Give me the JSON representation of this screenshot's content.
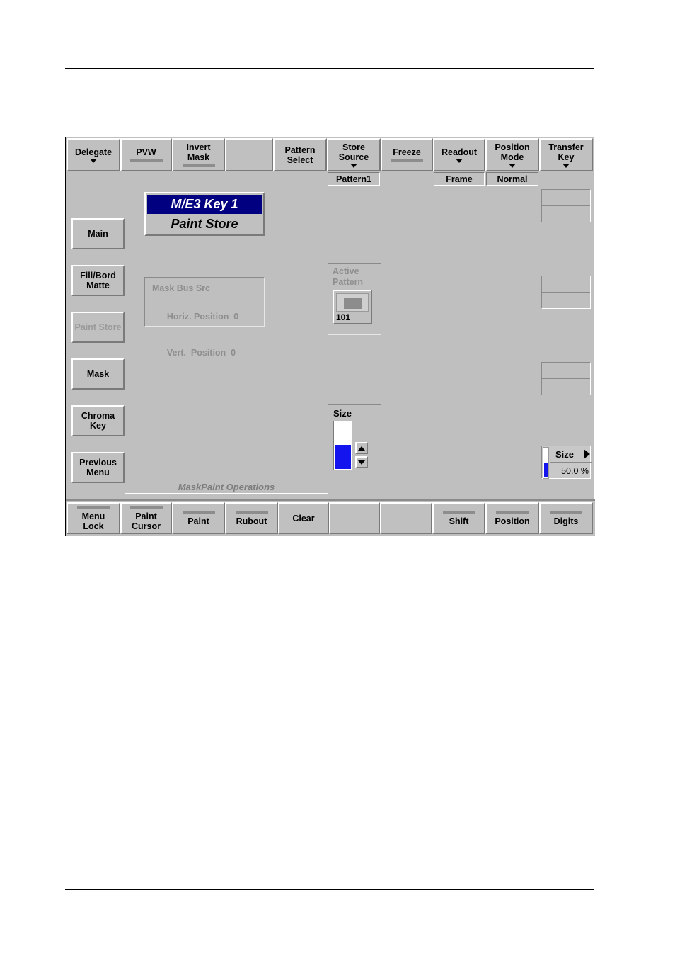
{
  "panel": {
    "title_line1": "M/E3 Key 1",
    "title_line2": "Paint Store",
    "ops_caption": "MaskPaint Operations"
  },
  "top_toolbar": {
    "buttons": [
      {
        "label": "Delegate",
        "indicator": "arrow"
      },
      {
        "label": "PVW",
        "indicator": "bar"
      },
      {
        "label": "Invert\nMask",
        "indicator": "bar"
      },
      {
        "label": "",
        "indicator": "none"
      },
      {
        "label": "Pattern\nSelect",
        "indicator": "none"
      },
      {
        "label": "Store\nSource",
        "indicator": "arrow"
      },
      {
        "label": "Freeze",
        "indicator": "bar"
      },
      {
        "label": "Readout",
        "indicator": "arrow"
      },
      {
        "label": "Position\nMode",
        "indicator": "arrow"
      },
      {
        "label": "Transfer\nKey",
        "indicator": "arrow"
      }
    ],
    "readouts": [
      {
        "value": "Pattern1"
      },
      {
        "value": "Frame"
      },
      {
        "value": "Normal"
      }
    ]
  },
  "left_menu": {
    "buttons": [
      {
        "label": "Main",
        "disabled": false
      },
      {
        "label": "Fill/Bord\nMatte",
        "disabled": false
      },
      {
        "label": "Paint\nStore",
        "disabled": true
      },
      {
        "label": "Mask",
        "disabled": false
      },
      {
        "label": "Chroma\nKey",
        "disabled": false
      },
      {
        "label": "Previous\nMenu",
        "disabled": false
      }
    ]
  },
  "mask_info": {
    "header": "Mask Bus Src",
    "rows": [
      {
        "label": "Horiz. Position",
        "value": "0"
      },
      {
        "label": "Vert.  Position",
        "value": "0"
      }
    ]
  },
  "active_pattern": {
    "label_line1": "Active",
    "label_line2": "Pattern",
    "number": "101"
  },
  "size_group": {
    "label": "Size",
    "fill_percent": "50"
  },
  "size_knob": {
    "label": "Size",
    "value": "50.0 %",
    "fill_percent": "50"
  },
  "right_readouts": [
    {
      "top": "",
      "bottom": ""
    },
    {
      "top": "",
      "bottom": ""
    },
    {
      "top": "",
      "bottom": ""
    }
  ],
  "bottom_toolbar": {
    "buttons": [
      {
        "label": "Menu\nLock",
        "indicator": "bar"
      },
      {
        "label": "Paint\nCursor",
        "indicator": "bar"
      },
      {
        "label": "Paint",
        "indicator": "bar"
      },
      {
        "label": "Rubout",
        "indicator": "bar"
      },
      {
        "label": "Clear",
        "indicator": "none"
      },
      {
        "label": "",
        "indicator": "none"
      },
      {
        "label": "",
        "indicator": "none"
      },
      {
        "label": "Shift",
        "indicator": "bar"
      },
      {
        "label": "Position",
        "indicator": "bar"
      },
      {
        "label": "Digits",
        "indicator": "bar"
      }
    ]
  },
  "colors": {
    "panel_face": "#bfbfbf",
    "button_face": "#c0c0c0",
    "title_highlight": "#000080",
    "slider_fill": "#1414ef",
    "disabled_text": "#9a9a9a"
  }
}
